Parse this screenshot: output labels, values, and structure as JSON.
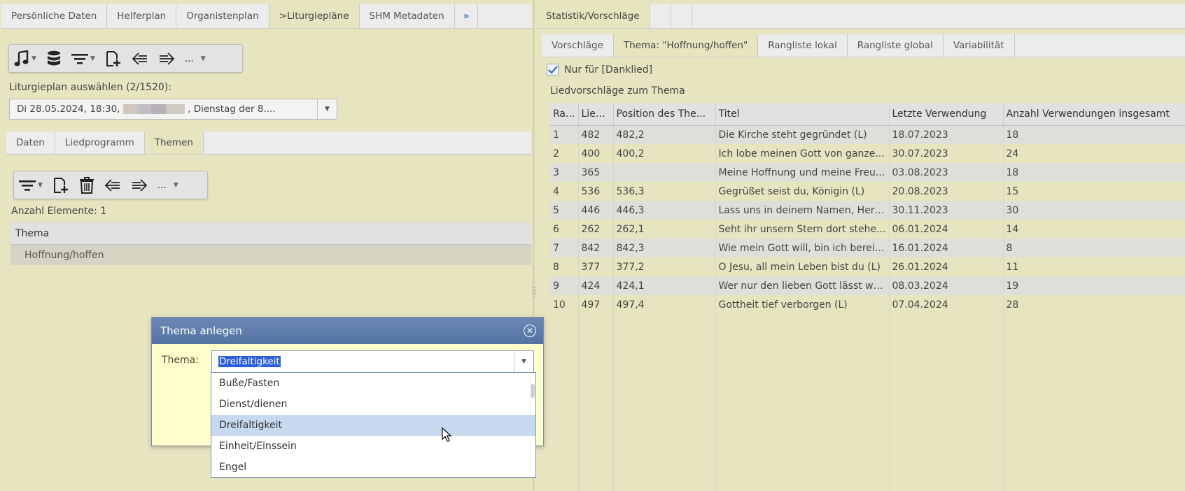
{
  "left": {
    "tabs": [
      {
        "label": "Persönliche Daten"
      },
      {
        "label": "Helferplan"
      },
      {
        "label": "Organistenplan"
      },
      {
        "label": ">Liturgiepläne"
      },
      {
        "label": "SHM Metadaten"
      },
      {
        "label": "»"
      }
    ],
    "toolbar": {
      "more": "..."
    },
    "liturgy_label": "Liturgieplan auswählen (2/1520):",
    "liturgy_select": {
      "prefix": "Di 28.05.2024, 18:30,",
      "suffix": ", Dienstag der 8...."
    },
    "sub_tabs": [
      {
        "label": "Daten"
      },
      {
        "label": "Liedprogramm"
      },
      {
        "label": "Themen"
      }
    ],
    "theme_toolbar": {
      "more": "..."
    },
    "count_label": "Anzahl Elemente: 1",
    "theme_table": {
      "header": "Thema",
      "rows": [
        "Hoffnung/hoffen"
      ]
    }
  },
  "right": {
    "tabs": [
      {
        "label": "Statistik/Vorschläge"
      },
      {
        "label": ""
      },
      {
        "label": ""
      }
    ],
    "sub_tabs": [
      {
        "label": "Vorschläge"
      },
      {
        "label": "Thema: \"Hoffnung/hoffen\""
      },
      {
        "label": "Rangliste lokal"
      },
      {
        "label": "Rangliste global"
      },
      {
        "label": "Variabilität"
      }
    ],
    "checkbox_label": "Nur für [Danklied]",
    "suggestions_label": "Liedvorschläge zum Thema",
    "table": {
      "headers": [
        "Ra...",
        "Lied...",
        "Position des The...",
        "Titel",
        "Letzte Verwendung",
        "Anzahl Verwendungen insgesamt"
      ],
      "rows": [
        [
          "1",
          "482",
          "482,2",
          "Die Kirche steht gegründet (L)",
          "18.07.2023",
          "18"
        ],
        [
          "2",
          "400",
          "400,2",
          "Ich lobe meinen Gott von ganze...",
          "30.07.2023",
          "24"
        ],
        [
          "3",
          "365",
          "",
          "Meine Hoffnung und meine Freu...",
          "03.08.2023",
          "18"
        ],
        [
          "4",
          "536",
          "536,3",
          "Gegrüßet seist du, Königin (L)",
          "20.08.2023",
          "15"
        ],
        [
          "5",
          "446",
          "446,3",
          "Lass uns in deinem Namen, Herr...",
          "30.11.2023",
          "30"
        ],
        [
          "6",
          "262",
          "262,1",
          "Seht ihr unsern Stern dort stehe...",
          "06.01.2024",
          "14"
        ],
        [
          "7",
          "842",
          "842,3",
          "Wie mein Gott will, bin ich bereit...",
          "16.01.2024",
          "8"
        ],
        [
          "8",
          "377",
          "377,2",
          "O Jesu, all mein Leben bist du (L)",
          "26.01.2024",
          "11"
        ],
        [
          "9",
          "424",
          "424,1",
          "Wer nur den lieben Gott lässt wa...",
          "08.03.2024",
          "19"
        ],
        [
          "10",
          "497",
          "497,4",
          "Gottheit tief verborgen (L)",
          "07.04.2024",
          "28"
        ]
      ]
    }
  },
  "dialog": {
    "title": "Thema anlegen",
    "field_label": "Thema:",
    "value": "Dreifaltigkeit",
    "options": [
      "Buße/Fasten",
      "Dienst/dienen",
      "Dreifaltigkeit",
      "Einheit/Einssein",
      "Engel"
    ],
    "selected_index": 2
  }
}
